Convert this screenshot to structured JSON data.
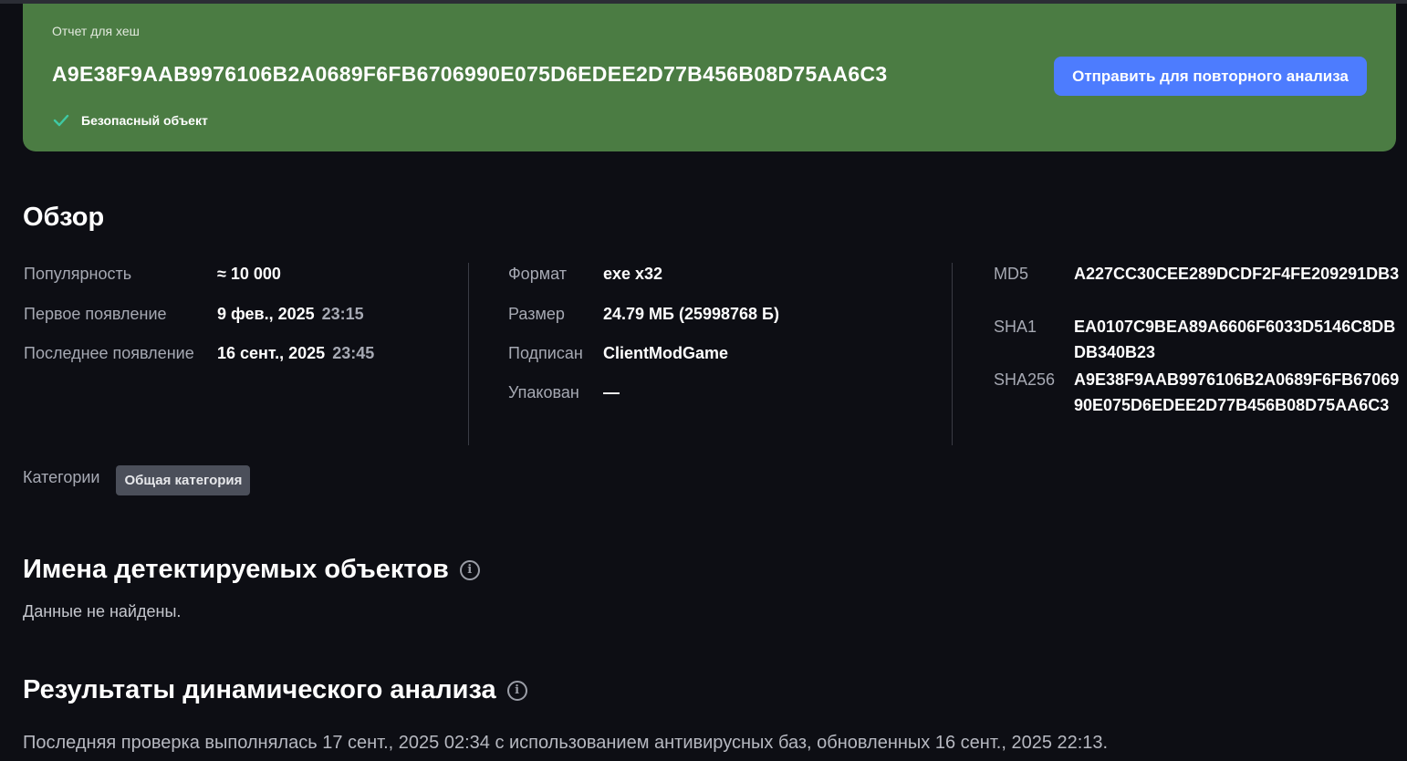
{
  "banner": {
    "label": "Отчет для хеш",
    "hash": "A9E38F9AAB9976106B2A0689F6FB6706990E075D6EDEE2D77B456B08D75AA6C3",
    "status": "Безопасный объект",
    "reanalyze_label": "Отправить для повторного анализа",
    "bg_color": "#4b7c43",
    "button_color": "#4d7cfe"
  },
  "overview": {
    "title": "Обзор",
    "popularity": {
      "label": "Популярность",
      "value": "≈ 10 000"
    },
    "first_seen": {
      "label": "Первое появление",
      "date": "9 фев., 2025",
      "time": "23:15"
    },
    "last_seen": {
      "label": "Последнее появление",
      "date": "16 сент., 2025",
      "time": "23:45"
    },
    "format": {
      "label": "Формат",
      "value": "exe x32"
    },
    "size": {
      "label": "Размер",
      "value": "24.79 МБ (25998768 Б)"
    },
    "signed": {
      "label": "Подписан",
      "value": "ClientModGame"
    },
    "packed": {
      "label": "Упакован",
      "value": "—"
    },
    "md5": {
      "label": "MD5",
      "value": "A227CC30CEE289DCDF2F4FE209291DB3"
    },
    "sha1": {
      "label": "SHA1",
      "value": "EA0107C9BEA89A6606F6033D5146C8DBDB340B23"
    },
    "sha256": {
      "label": "SHA256",
      "value": "A9E38F9AAB9976106B2A0689F6FB6706990E075D6EDEE2D77B456B08D75AA6C3"
    }
  },
  "categories": {
    "label": "Категории",
    "items": [
      "Общая категория"
    ]
  },
  "detections": {
    "title": "Имена детектируемых объектов",
    "empty_text": "Данные не найдены."
  },
  "dynamic": {
    "title": "Результаты динамического анализа",
    "last_check": "Последняя проверка выполнялась 17 сент., 2025 02:34 с использованием антивирусных баз, обновленных 16 сент., 2025 22:13."
  }
}
